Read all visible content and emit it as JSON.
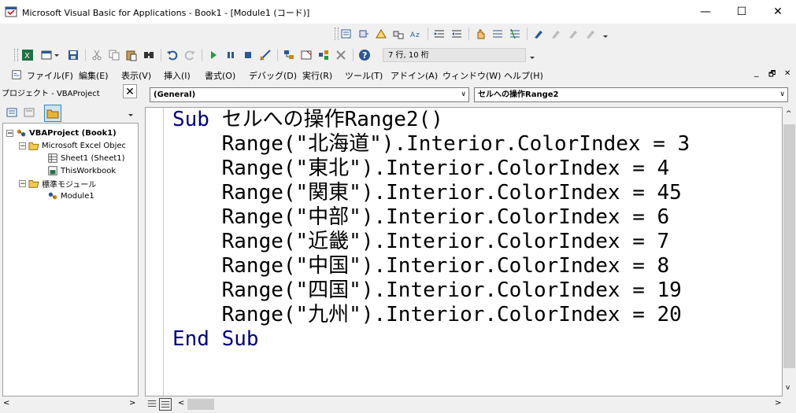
{
  "window": {
    "title": "Microsoft Visual Basic for Applications - Book1 - [Module1 (コード)]",
    "minimize": "—",
    "maximize": "☐",
    "close": "✕",
    "child_minimize": "_",
    "child_restore": "🗗",
    "child_close": "✕"
  },
  "status": {
    "position": "7 行, 10 桁"
  },
  "menu": [
    {
      "label": "ファイル(F)"
    },
    {
      "label": "編集(E)"
    },
    {
      "label": "表示(V)"
    },
    {
      "label": "挿入(I)"
    },
    {
      "label": "書式(O)"
    },
    {
      "label": "デバッグ(D)"
    },
    {
      "label": "実行(R)"
    },
    {
      "label": "ツール(T)"
    },
    {
      "label": "アドイン(A)"
    },
    {
      "label": "ウィンドウ(W)"
    },
    {
      "label": "ヘルプ(H)"
    }
  ],
  "project": {
    "title": "プロジェクト - VBAProject",
    "close": "✕",
    "tree": {
      "root": "VBAProject (Book1)",
      "excel_objects": "Microsoft Excel Objec",
      "sheet1": "Sheet1 (Sheet1)",
      "workbook": "ThisWorkbook",
      "modules": "標準モジュール",
      "module1": "Module1"
    }
  },
  "editor": {
    "object_combo": "(General)",
    "proc_combo": "セルへの操作Range2",
    "lines": [
      {
        "kw": "Sub",
        "text": " セルへの操作Range2()"
      },
      {
        "kw": "",
        "text": "    Range(\"北海道\").Interior.ColorIndex = 3"
      },
      {
        "kw": "",
        "text": "    Range(\"東北\").Interior.ColorIndex = 4"
      },
      {
        "kw": "",
        "text": "    Range(\"関東\").Interior.ColorIndex = 45"
      },
      {
        "kw": "",
        "text": "    Range(\"中部\").Interior.ColorIndex = 6"
      },
      {
        "kw": "",
        "text": "    Range(\"近畿\").Interior.ColorIndex = 7"
      },
      {
        "kw": "",
        "text": "    Range(\"中国\").Interior.ColorIndex = 8"
      },
      {
        "kw": "",
        "text": "    Range(\"四国\").Interior.ColorIndex = 19"
      },
      {
        "kw": "",
        "text": "    Range(\"九州\").Interior.ColorIndex = 20"
      },
      {
        "kw": "End Sub",
        "text": ""
      }
    ]
  },
  "colors": {
    "keyword": "#000080"
  }
}
